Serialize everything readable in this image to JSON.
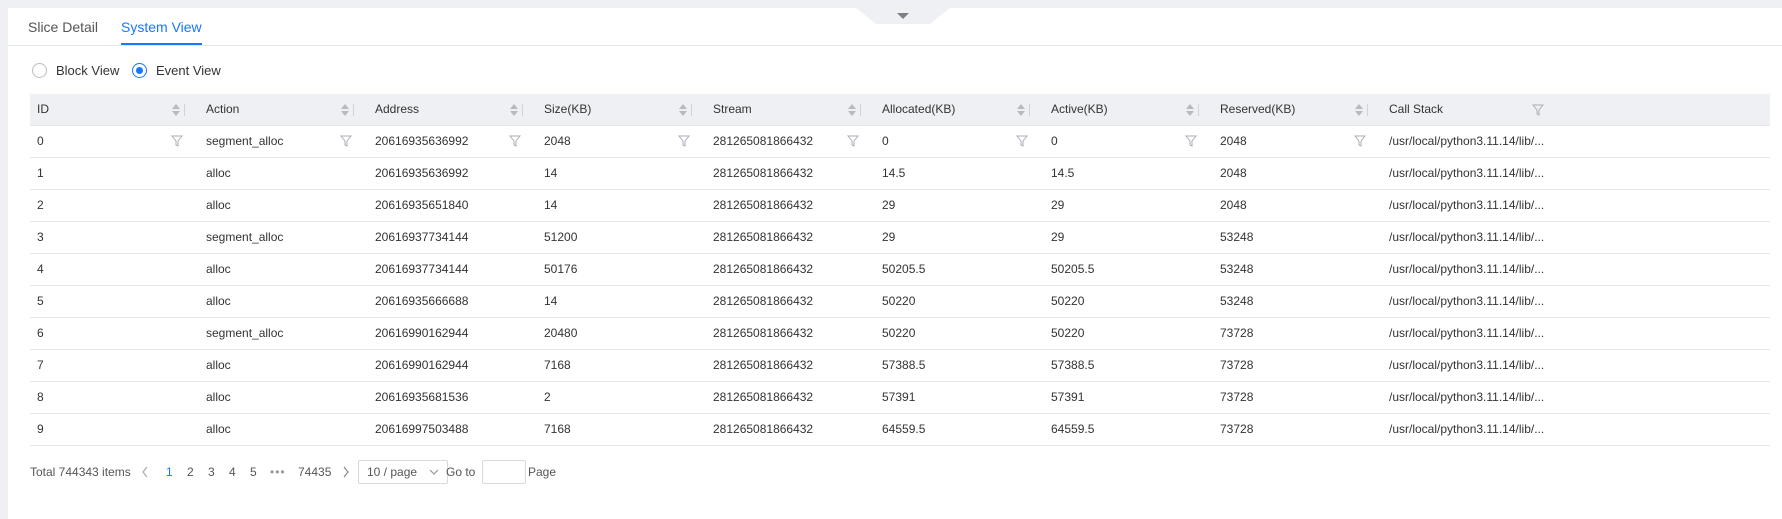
{
  "tabs": [
    {
      "label": "Slice Detail",
      "active": false
    },
    {
      "label": "System View",
      "active": true
    }
  ],
  "view_mode": {
    "options": [
      {
        "label": "Block View",
        "checked": false
      },
      {
        "label": "Event View",
        "checked": true
      }
    ]
  },
  "table": {
    "columns": [
      "ID",
      "Action",
      "Address",
      "Size(KB)",
      "Stream",
      "Allocated(KB)",
      "Active(KB)",
      "Reserved(KB)",
      "Call Stack"
    ],
    "rows": [
      [
        "0",
        "segment_alloc",
        "20616935636992",
        "2048",
        "281265081866432",
        "0",
        "0",
        "2048",
        "/usr/local/python3.11.14/lib/..."
      ],
      [
        "1",
        "alloc",
        "20616935636992",
        "14",
        "281265081866432",
        "14.5",
        "14.5",
        "2048",
        "/usr/local/python3.11.14/lib/..."
      ],
      [
        "2",
        "alloc",
        "20616935651840",
        "14",
        "281265081866432",
        "29",
        "29",
        "2048",
        "/usr/local/python3.11.14/lib/..."
      ],
      [
        "3",
        "segment_alloc",
        "20616937734144",
        "51200",
        "281265081866432",
        "29",
        "29",
        "53248",
        "/usr/local/python3.11.14/lib/..."
      ],
      [
        "4",
        "alloc",
        "20616937734144",
        "50176",
        "281265081866432",
        "50205.5",
        "50205.5",
        "53248",
        "/usr/local/python3.11.14/lib/..."
      ],
      [
        "5",
        "alloc",
        "20616935666688",
        "14",
        "281265081866432",
        "50220",
        "50220",
        "53248",
        "/usr/local/python3.11.14/lib/..."
      ],
      [
        "6",
        "segment_alloc",
        "20616990162944",
        "20480",
        "281265081866432",
        "50220",
        "50220",
        "73728",
        "/usr/local/python3.11.14/lib/..."
      ],
      [
        "7",
        "alloc",
        "20616990162944",
        "7168",
        "281265081866432",
        "57388.5",
        "57388.5",
        "73728",
        "/usr/local/python3.11.14/lib/..."
      ],
      [
        "8",
        "alloc",
        "20616935681536",
        "2",
        "281265081866432",
        "57391",
        "57391",
        "73728",
        "/usr/local/python3.11.14/lib/..."
      ],
      [
        "9",
        "alloc",
        "20616997503488",
        "7168",
        "281265081866432",
        "64559.5",
        "64559.5",
        "73728",
        "/usr/local/python3.11.14/lib/..."
      ]
    ]
  },
  "pagination": {
    "total_text": "Total 744343 items",
    "pages": [
      "1",
      "2",
      "3",
      "4",
      "5"
    ],
    "current_page": "1",
    "ellipsis": "•••",
    "last_page": "74435",
    "page_size": "10 / page",
    "goto_label": "Go to",
    "goto_value": "",
    "page_label": "Page"
  },
  "icons": {
    "collapse": "chevron-down-icon",
    "sort": "sort-icon",
    "filter": "filter-icon",
    "prev": "chevron-left-icon",
    "next": "chevron-right-icon",
    "select": "chevron-down-icon"
  },
  "colors": {
    "accent": "#1677ff",
    "header_bg": "#eef0f4",
    "page_bg": "#eef0f4"
  }
}
